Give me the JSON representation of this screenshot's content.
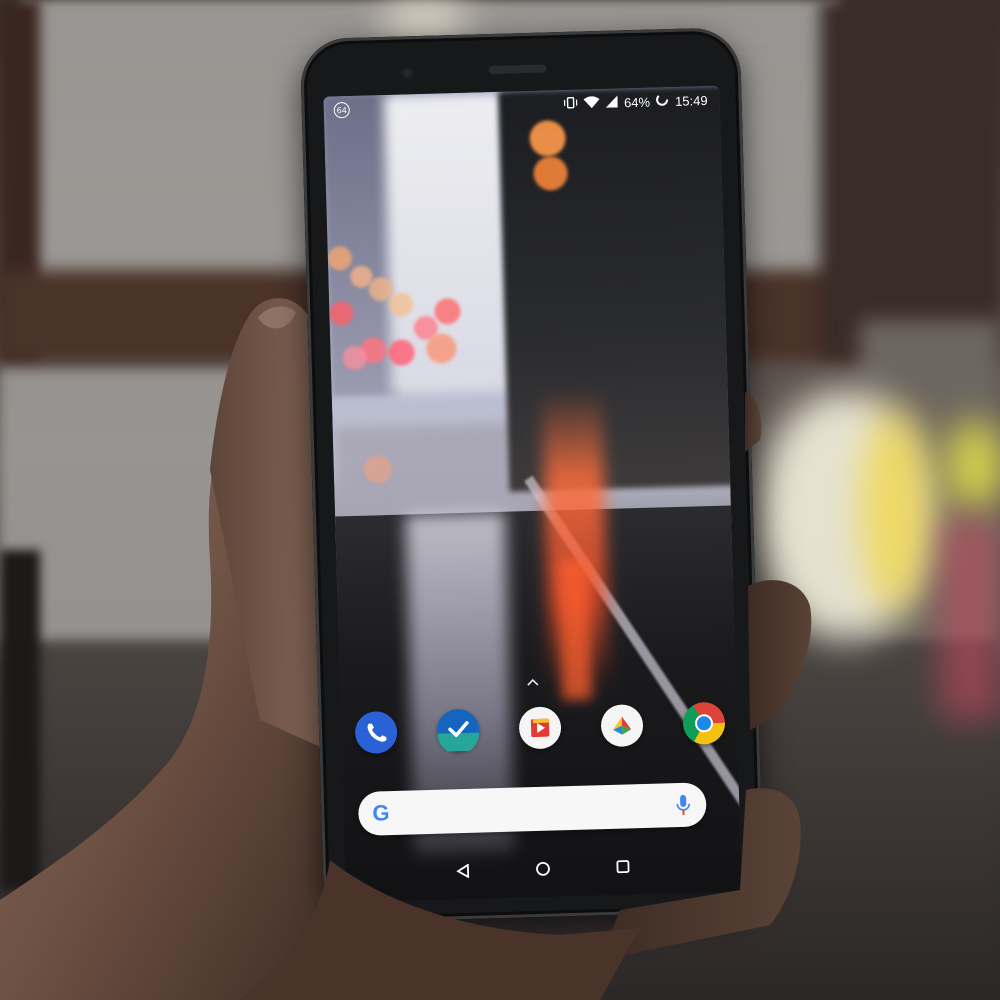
{
  "status_bar": {
    "notification_badge": "64",
    "battery_percent": "64%",
    "time": "15:49",
    "icons": [
      "vibrate-icon",
      "wifi-icon",
      "signal-icon",
      "battery-icon"
    ]
  },
  "home_screen": {
    "dock_apps": [
      {
        "name": "phone-app-icon"
      },
      {
        "name": "tasks-app-icon"
      },
      {
        "name": "play-movies-app-icon"
      },
      {
        "name": "photos-app-icon"
      },
      {
        "name": "chrome-app-icon"
      }
    ],
    "search_bar": {
      "logo": "G",
      "mic_icon": "mic-icon"
    }
  },
  "nav_bar": {
    "icons": [
      "back-icon",
      "home-icon",
      "recents-icon"
    ]
  },
  "colors": {
    "search_bar": "#f7f7f7",
    "phone_body": "#17181a"
  }
}
